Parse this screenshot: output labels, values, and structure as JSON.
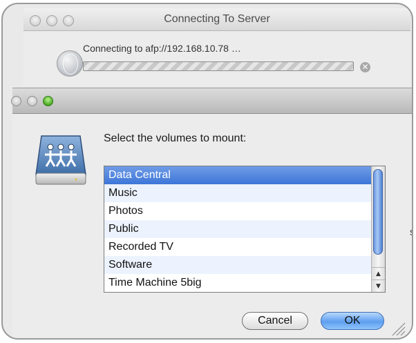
{
  "back_dialog": {
    "title": "Connecting To Server",
    "status_text": "Connecting to afp://192.168.10.78 …",
    "cancel_glyph": "✕"
  },
  "front_dialog": {
    "prompt": "Select the volumes to mount:",
    "volumes": [
      "Data Central",
      "Music",
      "Photos",
      "Public",
      "Recorded TV",
      "Software",
      "Time Machine 5big"
    ],
    "selected_index": 0,
    "cancel_label": "Cancel",
    "ok_label": "OK",
    "scroll_up_glyph": "▲",
    "scroll_down_glyph": "▼"
  },
  "side_text": "s",
  "icons": {
    "server": "shared-server-icon",
    "connecting": "globe-icon"
  },
  "colors": {
    "selection": "#3d76d8",
    "ok_button": "#5e9ff0",
    "green_light": "#3fa31c"
  }
}
